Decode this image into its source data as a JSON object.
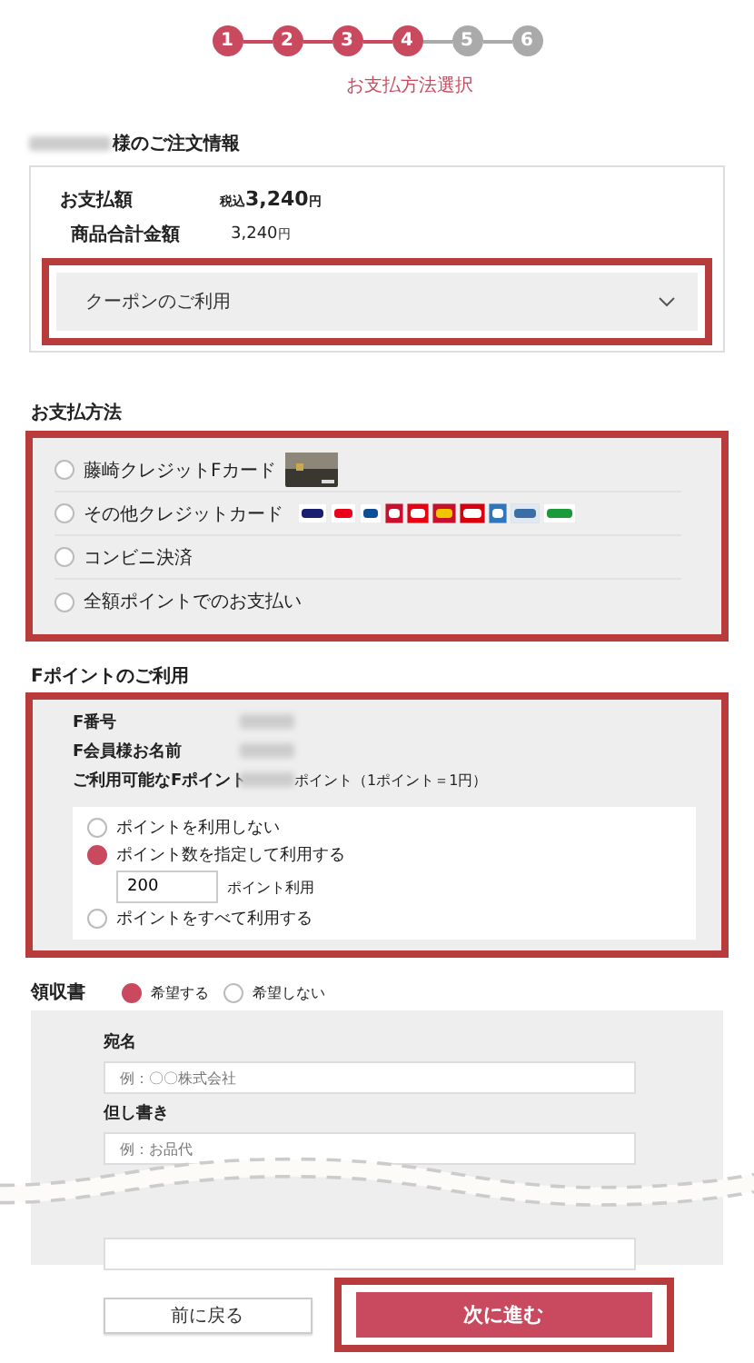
{
  "steps": [
    {
      "number": "1",
      "active": true
    },
    {
      "number": "2",
      "active": true
    },
    {
      "number": "3",
      "active": true
    },
    {
      "number": "4",
      "active": true
    },
    {
      "number": "5",
      "active": false
    },
    {
      "number": "6",
      "active": false
    }
  ],
  "step_label": "お支払方法選択",
  "order": {
    "heading": "様のご注文情報",
    "name_redacted": true,
    "rows": [
      {
        "label": "お支払額",
        "prefix": "税込",
        "value": "3,240",
        "unit": "円",
        "kind": "total"
      },
      {
        "label": "商品合計金額",
        "value": "3,240",
        "unit": "円",
        "kind": "sub"
      }
    ],
    "coupon": {
      "label": "クーポンのご利用",
      "expanded": false,
      "highlighted": true
    }
  },
  "payment": {
    "heading": "お支払方法",
    "highlighted": true,
    "options": [
      {
        "label": "藤崎クレジットFカード",
        "selected": false,
        "kind": "house_card"
      },
      {
        "label": "その他クレジットカード",
        "selected": false,
        "kind": "cards"
      },
      {
        "label": "コンビニ決済",
        "selected": false,
        "kind": "plain"
      },
      {
        "label": "全額ポイントでのお支払い",
        "selected": false,
        "kind": "plain"
      }
    ]
  },
  "fpoint": {
    "heading": "Fポイントのご利用",
    "highlighted": true,
    "rows": [
      {
        "label": "F番号",
        "value_redacted": true
      },
      {
        "label": "F会員様お名前",
        "value_redacted": true
      },
      {
        "label": "ご利用可能なFポイント",
        "value_redacted": true,
        "suffix": "ポイント（1ポイント＝1円）"
      }
    ],
    "options": [
      {
        "label": "ポイントを利用しない",
        "selected": false
      },
      {
        "label": "ポイント数を指定して利用する",
        "selected": true,
        "input": {
          "value": "200",
          "suffix": "ポイント利用"
        }
      },
      {
        "label": "ポイントをすべて利用する",
        "selected": false
      }
    ]
  },
  "receipt": {
    "heading": "領収書",
    "options": [
      {
        "label": "希望する",
        "selected": true
      },
      {
        "label": "希望しない",
        "selected": false
      }
    ],
    "fields": [
      {
        "label": "宛名",
        "placeholder": "例：〇〇株式会社"
      },
      {
        "label": "但し書き",
        "placeholder": "例：お品代"
      }
    ]
  },
  "buttons": {
    "back": {
      "label": "前に戻る"
    },
    "next": {
      "label": "次に進む",
      "highlighted": true
    }
  }
}
